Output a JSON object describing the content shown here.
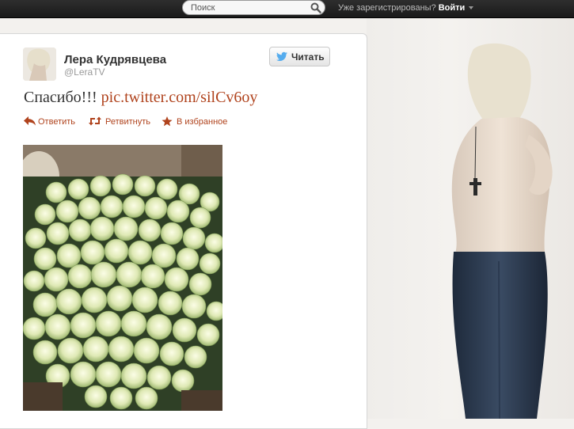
{
  "topbar": {
    "search_placeholder": "Поиск",
    "login_prompt": "Уже зарегистрированы?",
    "login_link": "Войти"
  },
  "tweet": {
    "user_name": "Лера Кудрявцева",
    "user_handle": "@LeraTV",
    "follow_label": "Читать",
    "text": "Спасибо!!!",
    "link": "pic.twitter.com/silCv6oy",
    "actions": {
      "reply": "Ответить",
      "retweet": "Ретвитнуть",
      "favorite": "В избранное"
    }
  },
  "colors": {
    "link": "#b0431d",
    "topbar": "#1f1f1f",
    "text": "#333333"
  },
  "icons": [
    "search-icon",
    "twitter-bird-icon",
    "reply-icon",
    "retweet-icon",
    "star-icon"
  ]
}
